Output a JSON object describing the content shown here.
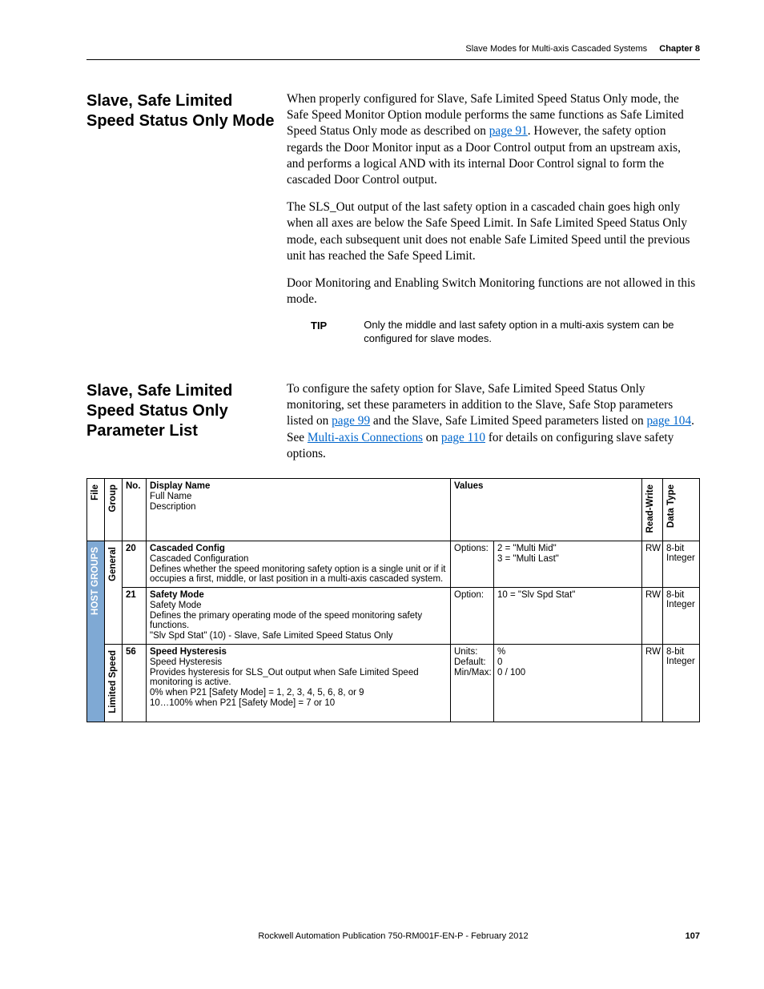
{
  "header": {
    "section_title": "Slave Modes for Multi-axis Cascaded Systems",
    "chapter_label": "Chapter 8"
  },
  "section1": {
    "heading": "Slave, Safe Limited Speed Status Only Mode",
    "para1a": "When properly configured for Slave, Safe Limited Speed Status Only mode, the Safe Speed Monitor Option module performs the same functions as Safe Limited Speed Status Only mode as described on ",
    "link1": "page 91",
    "para1b": ". However, the safety option regards the Door Monitor input as a Door Control output from an upstream axis, and performs a logical AND with its internal Door Control signal to form the cascaded Door Control output.",
    "para2": "The SLS_Out output of the last safety option in a cascaded chain goes high only when all axes are below the Safe Speed Limit. In Safe Limited Speed Status Only mode, each subsequent unit does not enable Safe Limited Speed until the previous unit has reached the Safe Speed Limit.",
    "para3": "Door Monitoring and Enabling Switch Monitoring functions are not allowed in this mode.",
    "tip_label": "TIP",
    "tip_text": "Only the middle and last safety option in a multi-axis system can be configured for slave modes."
  },
  "section2": {
    "heading": "Slave, Safe Limited Speed Status Only Parameter List",
    "para_a": "To configure the safety option for Slave, Safe Limited Speed Status Only monitoring, set these parameters in addition to the Slave, Safe Stop parameters listed on ",
    "link1": "page 99",
    "para_b": " and the Slave, Safe Limited Speed parameters listed on ",
    "link2": "page 104",
    "para_c": ". See ",
    "link3": "Multi-axis Connections",
    "para_d": " on ",
    "link4": "page 110",
    "para_e": " for details on configuring slave safety options."
  },
  "table": {
    "headers": {
      "file": "File",
      "group": "Group",
      "no": "No.",
      "display_name": "Display Name",
      "full_name": "Full Name",
      "description": "Description",
      "values": "Values",
      "read_write": "Read-Write",
      "data_type": "Data Type"
    },
    "file_label": "HOST GROUPS",
    "group1_label": "General",
    "group2_label": "Limited Speed",
    "rows": [
      {
        "no": "20",
        "dn": "Cascaded Config",
        "fn": "Cascaded Configuration",
        "desc": "Defines whether the speed monitoring safety option is a single unit or if it occupies a first, middle, or last position in a multi-axis cascaded system.",
        "val_l": "Options:",
        "val_r1": "2 = \"Multi Mid\"",
        "val_r2": "3 = \"Multi Last\"",
        "rw": "RW",
        "dt": "8-bit Integer"
      },
      {
        "no": "21",
        "dn": "Safety Mode",
        "fn": "Safety Mode",
        "desc1": "Defines the primary operating mode of the speed monitoring safety functions.",
        "desc2": "\"Slv Spd Stat\" (10) - Slave, Safe Limited Speed Status Only",
        "val_l": "Option:",
        "val_r1": "10 = \"Slv Spd Stat\"",
        "rw": "RW",
        "dt": "8-bit Integer"
      },
      {
        "no": "56",
        "dn": "Speed Hysteresis",
        "fn": "Speed Hysteresis",
        "desc1": "Provides hysteresis for SLS_Out output when Safe Limited Speed monitoring is active.",
        "desc2": "0% when P21 [Safety Mode] = 1, 2, 3, 4, 5, 6, 8, or 9",
        "desc3": "10…100% when P21 [Safety Mode] = 7 or 10",
        "val_l1": "Units:",
        "val_l2": "Default:",
        "val_l3": "Min/Max:",
        "val_r1": "%",
        "val_r2": "0",
        "val_r3": "0 / 100",
        "rw": "RW",
        "dt": "8-bit Integer"
      }
    ]
  },
  "footer": {
    "pub": "Rockwell Automation Publication 750-RM001F-EN-P - February 2012",
    "page": "107"
  }
}
